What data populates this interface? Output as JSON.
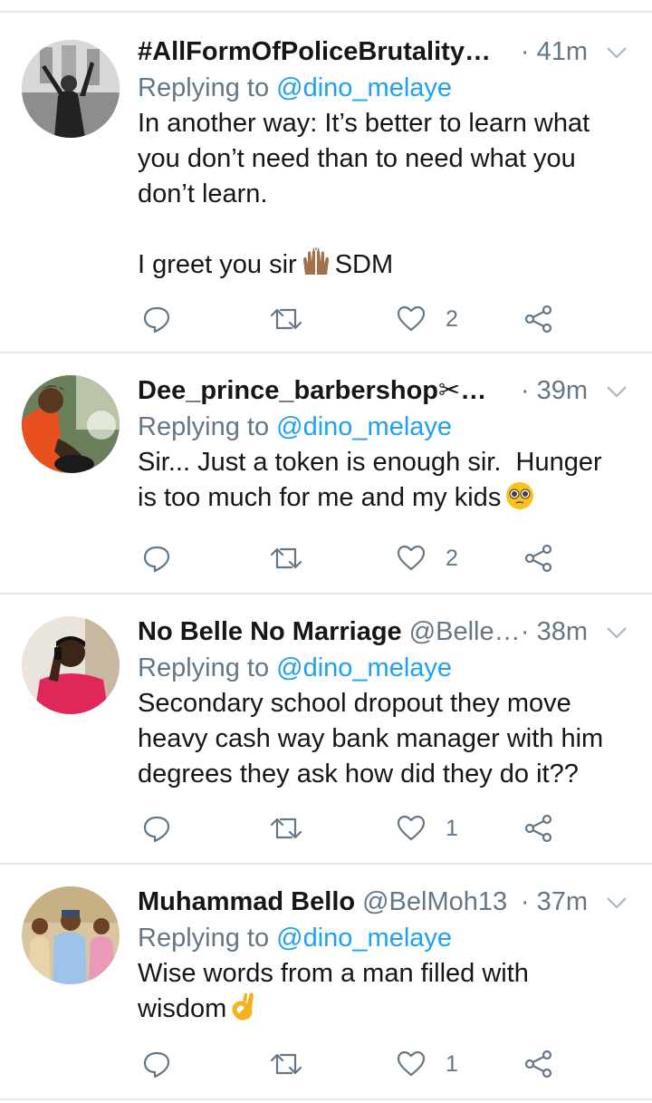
{
  "colors": {
    "accent": "#1da1f2",
    "muted": "#657786",
    "text": "#14171a",
    "divider": "#e1e8ed"
  },
  "tweets": [
    {
      "name": "#AllFormOfPoliceBrutalityM…",
      "handle": "",
      "time": "· 41m",
      "replying_prefix": "Replying to",
      "replying_to": "@dino_melaye",
      "text_lines": [
        "In another way: It’s better to learn what",
        "you don’t need than to need what you",
        "don’t learn.",
        "",
        "I greet you sir"
      ],
      "text_suffix": "SDM",
      "emoji": "raising-hands-emoji",
      "like_count": "2"
    },
    {
      "name": "Dee_prince_barbershop✂💸…",
      "handle": "",
      "time": "· 39m",
      "replying_prefix": "Replying to",
      "replying_to": "@dino_melaye",
      "text_lines": [
        "Sir... Just a token is enough sir.  Hunger",
        "is too much for me and my kids"
      ],
      "emoji": "pleading-face-emoji",
      "like_count": "2"
    },
    {
      "name": "No Belle No Marriage",
      "handle": "@Belle…",
      "time": "· 38m",
      "replying_prefix": "Replying to",
      "replying_to": "@dino_melaye",
      "text_lines": [
        "Secondary school dropout they move",
        "heavy cash way bank manager with him",
        "degrees they ask how did they do it??"
      ],
      "like_count": "1"
    },
    {
      "name": "Muhammad Bello",
      "handle": "@BelMoh13",
      "time": "· 37m",
      "replying_prefix": "Replying to",
      "replying_to": "@dino_melaye",
      "text_lines": [
        "Wise words from a man filled with",
        "wisdom"
      ],
      "emoji": "ok-hand-emoji",
      "like_count": "1"
    }
  ]
}
